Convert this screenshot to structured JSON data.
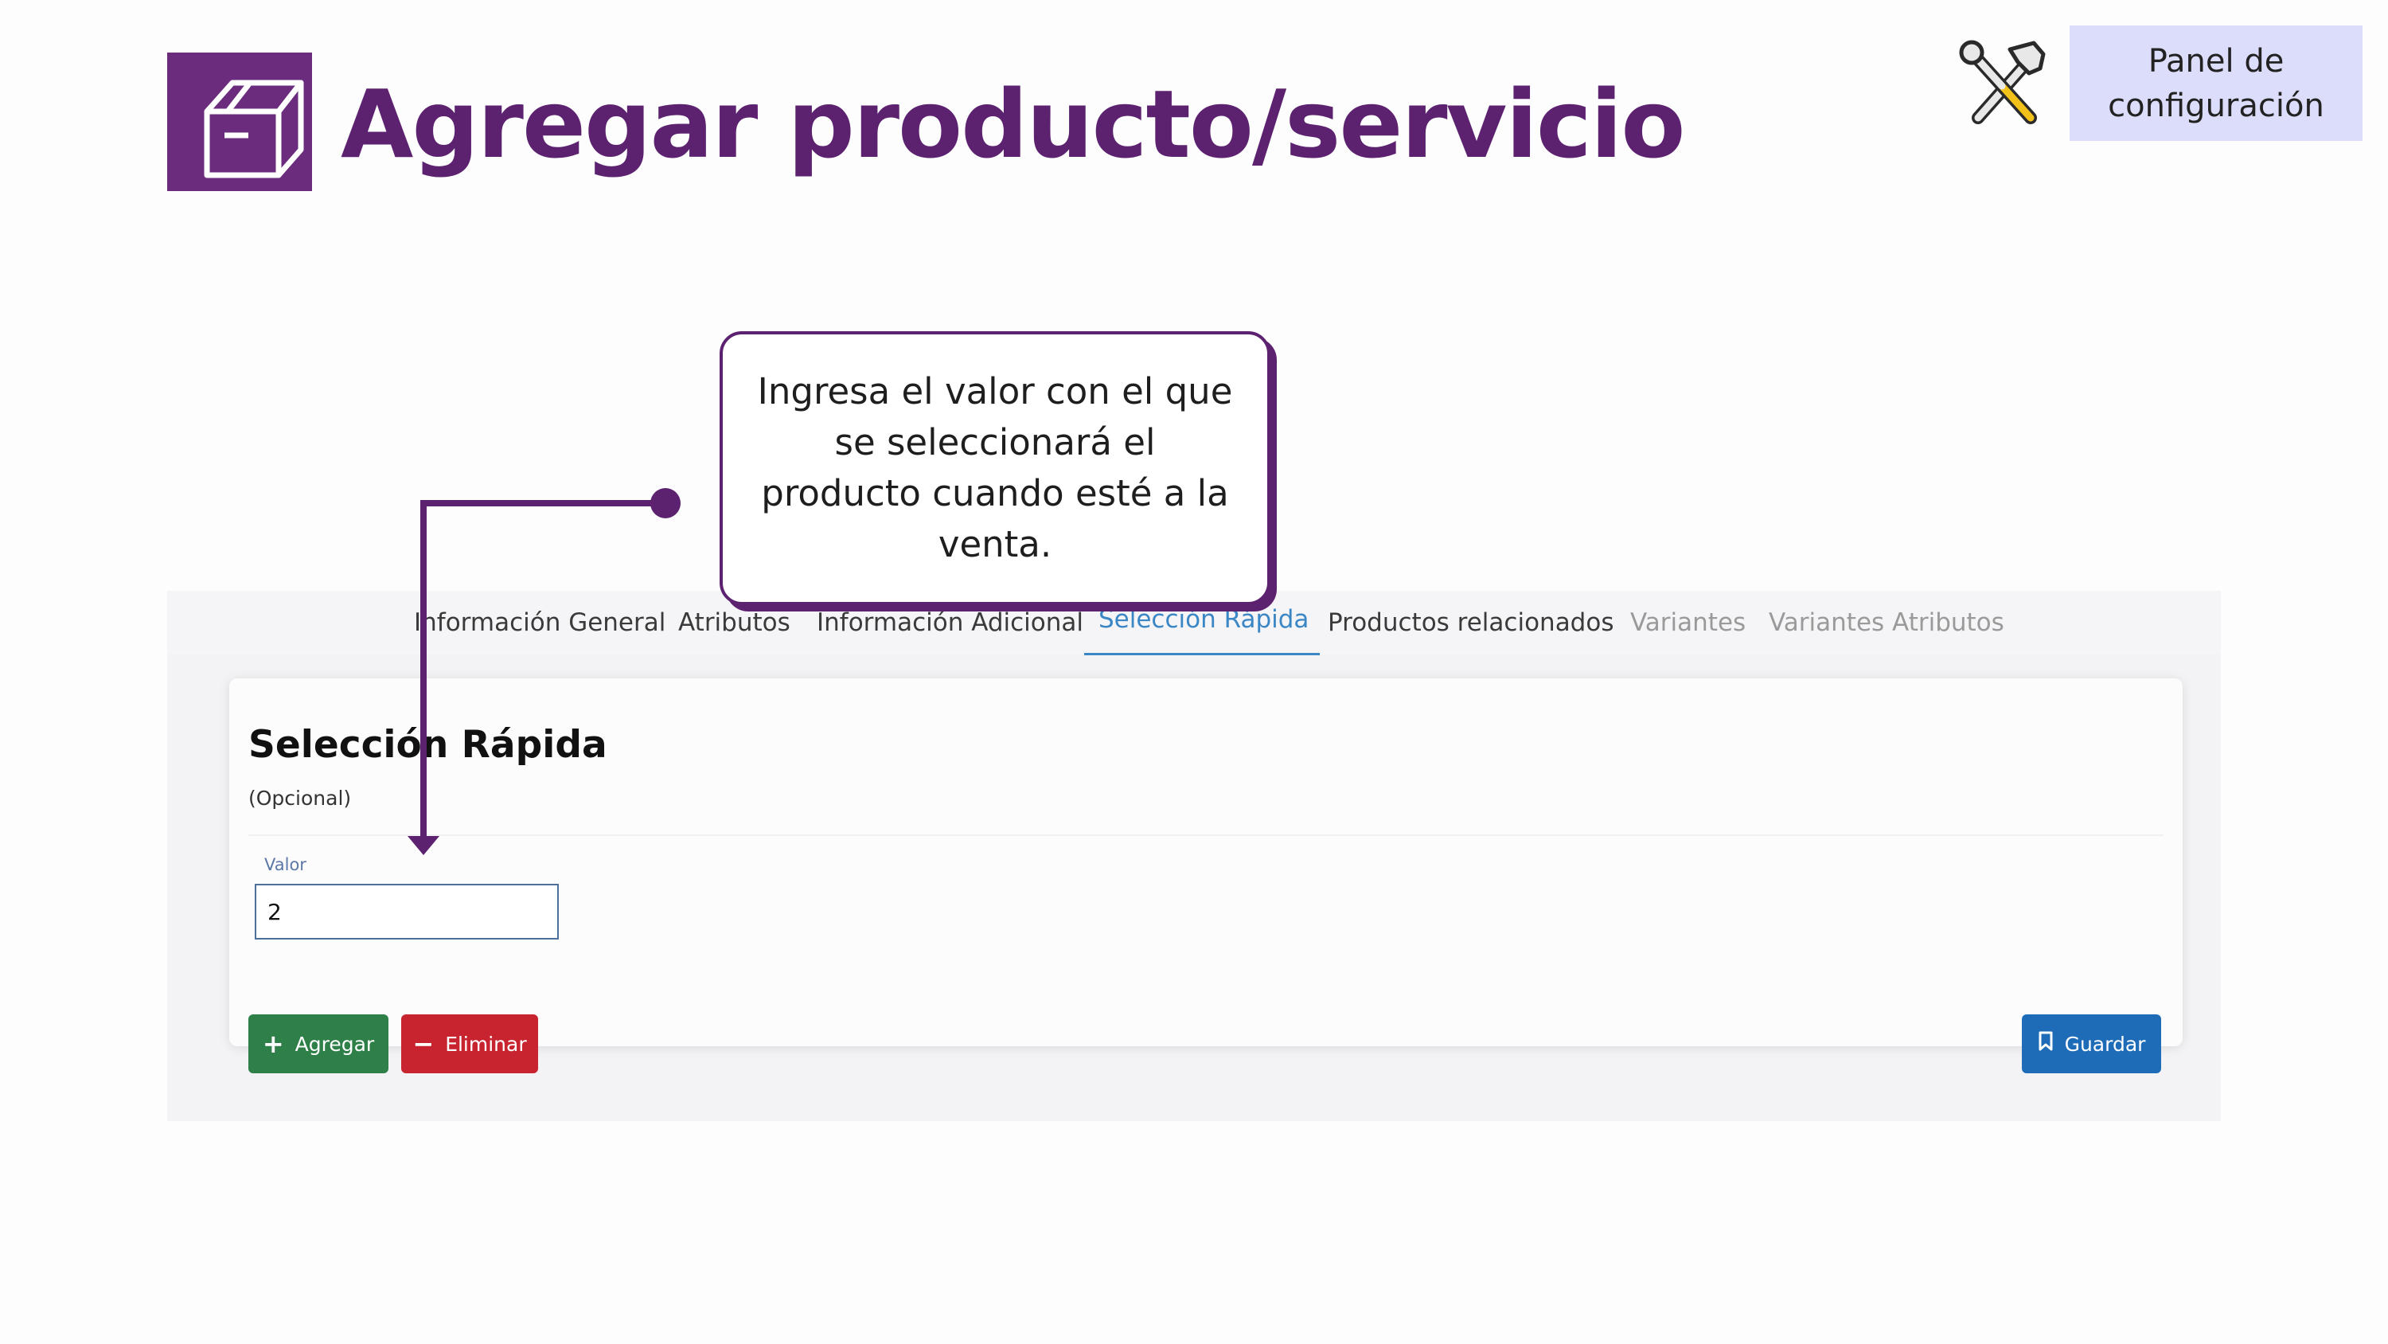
{
  "header": {
    "title": "Agregar producto/servicio",
    "title_icon": "box-icon",
    "tools_icon": "tools-icon",
    "config_panel": {
      "line1": "Panel de",
      "line2": "configuración"
    }
  },
  "callout": {
    "text": "Ingresa el valor con el que se seleccionará el producto cuando esté a la venta."
  },
  "tabs": [
    {
      "label": "Información General",
      "state": "normal"
    },
    {
      "label": "Atributos",
      "state": "normal"
    },
    {
      "label": "Información Adicional",
      "state": "normal"
    },
    {
      "label": "Selección Rápida",
      "state": "active"
    },
    {
      "label": "Productos relacionados",
      "state": "normal"
    },
    {
      "label": "Variantes",
      "state": "disabled"
    },
    {
      "label": "Variantes Atributos",
      "state": "disabled"
    }
  ],
  "section": {
    "title": "Selección Rápida",
    "subtitle": "(Opcional)",
    "field_label": "Valor",
    "field_value": "2"
  },
  "buttons": {
    "add": {
      "label": "Agregar",
      "icon": "plus-icon"
    },
    "remove": {
      "label": "Eliminar",
      "icon": "minus-icon"
    },
    "save": {
      "label": "Guardar",
      "icon": "bookmark-icon"
    }
  },
  "colors": {
    "brand_purple": "#5c2270",
    "panel_lavender": "#dcdcfb",
    "active_tab": "#3b86c5",
    "add_green": "#2e8048",
    "remove_red": "#c8242f",
    "save_blue": "#1e6bb8"
  }
}
